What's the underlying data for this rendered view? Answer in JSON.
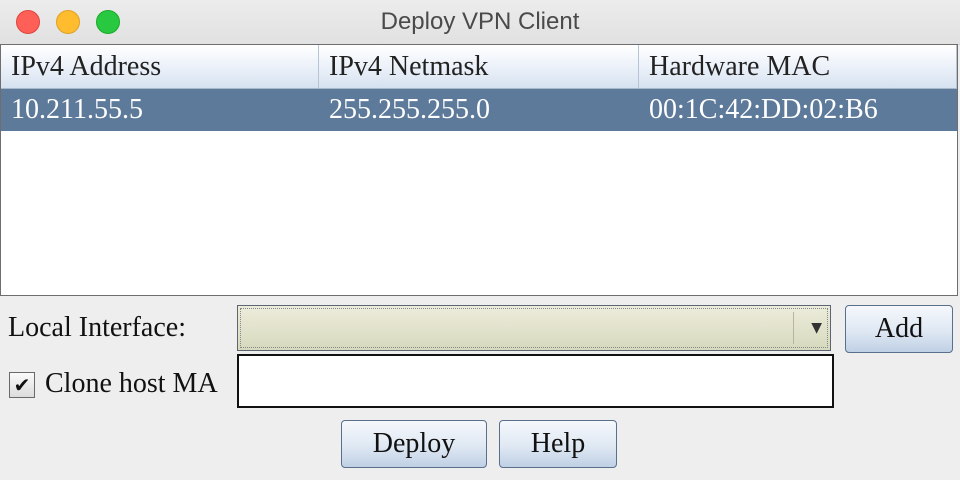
{
  "window": {
    "title": "Deploy VPN Client"
  },
  "table": {
    "columns": [
      "IPv4 Address",
      "IPv4 Netmask",
      "Hardware MAC"
    ],
    "rows": [
      [
        "10.211.55.5",
        "255.255.255.0",
        "00:1C:42:DD:02:B6"
      ]
    ]
  },
  "form": {
    "local_interface_label": "Local Interface:",
    "local_interface_value": "",
    "add_label": "Add",
    "clone_label": "Clone host MA",
    "clone_checked": true,
    "check_glyph": "✔",
    "dropdown_glyph": "▼",
    "deploy_label": "Deploy",
    "help_label": "Help"
  }
}
